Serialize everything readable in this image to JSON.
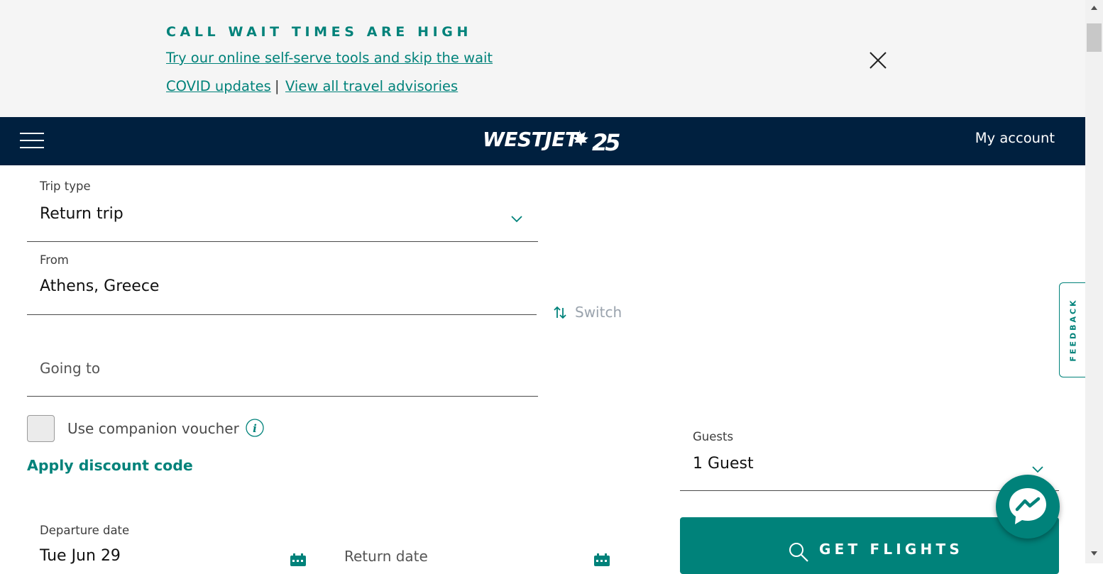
{
  "banner": {
    "heading": "CALL WAIT TIMES ARE HIGH",
    "self_serve_link": "Try our online self-serve tools and skip the wait",
    "covid_link": "COVID updates",
    "separator": "|",
    "advisories_link": "View all travel advisories"
  },
  "header": {
    "brand": "WESTJET",
    "brand_mark": "25",
    "account": "My account"
  },
  "form": {
    "trip_type": {
      "label": "Trip type",
      "value": "Return trip"
    },
    "from": {
      "label": "From",
      "value": "Athens, Greece"
    },
    "switch_label": "Switch",
    "going_to": {
      "placeholder": "Going to"
    },
    "companion_voucher": {
      "label": "Use companion voucher",
      "checked": false
    },
    "discount_link": "Apply discount code",
    "guests": {
      "label": "Guests",
      "value": "1 Guest"
    },
    "departure": {
      "label": "Departure date",
      "value": "Tue Jun 29"
    },
    "return": {
      "placeholder": "Return date"
    },
    "submit": "GET FLIGHTS"
  },
  "feedback": "FEEDBACK",
  "colors": {
    "accent": "#00827a",
    "navy": "#00203f",
    "banner_bg": "#f5f5f5"
  },
  "icons": [
    "menu-icon",
    "close-icon",
    "chevron-down-icon",
    "switch-arrows-icon",
    "info-icon",
    "calendar-icon",
    "search-icon",
    "messenger-icon"
  ]
}
